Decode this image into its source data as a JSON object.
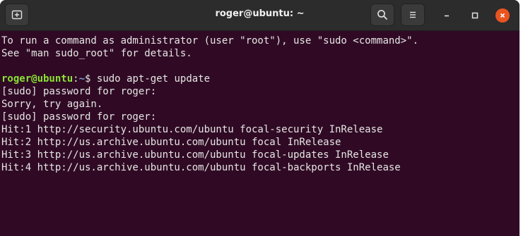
{
  "window": {
    "title": "roger@ubuntu: ~"
  },
  "icons": {
    "new_tab": "new-tab-icon",
    "search": "search-icon",
    "menu": "hamburger-menu-icon",
    "minimize": "minimize-icon",
    "maximize": "maximize-icon",
    "close": "close-icon"
  },
  "colors": {
    "terminal_bg": "#300a24",
    "text": "#e6e6e6",
    "prompt_user": "#8ae234",
    "prompt_path": "#729fcf",
    "close_accent": "#e95420"
  },
  "terminal": {
    "lines": [
      "To run a command as administrator (user \"root\"), use \"sudo <command>\".",
      "See \"man sudo_root\" for details.",
      ""
    ],
    "prompt": {
      "user_host": "roger@ubuntu",
      "colon": ":",
      "path": "~",
      "symbol": "$ ",
      "command": "sudo apt-get update"
    },
    "output": [
      "[sudo] password for roger:",
      "Sorry, try again.",
      "[sudo] password for roger:",
      "Hit:1 http://security.ubuntu.com/ubuntu focal-security InRelease",
      "Hit:2 http://us.archive.ubuntu.com/ubuntu focal InRelease",
      "Hit:3 http://us.archive.ubuntu.com/ubuntu focal-updates InRelease",
      "Hit:4 http://us.archive.ubuntu.com/ubuntu focal-backports InRelease"
    ]
  }
}
